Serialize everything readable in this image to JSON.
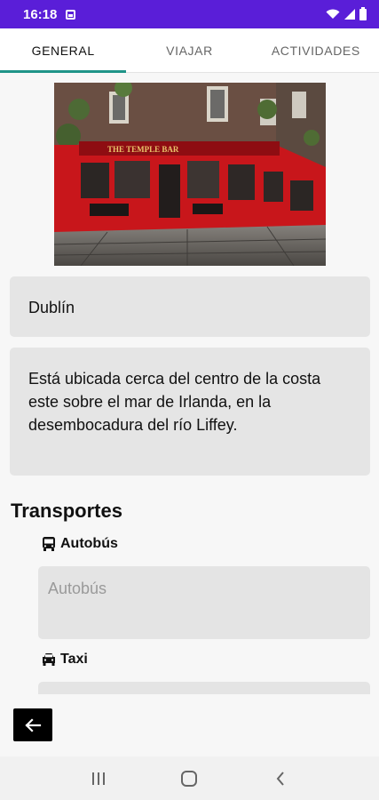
{
  "status_bar": {
    "time": "16:18"
  },
  "tabs": [
    {
      "label": "GENERAL",
      "active": true
    },
    {
      "label": "VIAJAR",
      "active": false
    },
    {
      "label": "ACTIVIDADES",
      "active": false
    }
  ],
  "city": {
    "name": "Dublín",
    "description": "Está ubicada cerca del centro de la costa este sobre el mar de Irlanda, en la desembocadura del río Liffey.",
    "image_sign_text": "THE TEMPLE BAR"
  },
  "transport": {
    "title": "Transportes",
    "bus": {
      "label": "Autobús",
      "placeholder": "Autobús"
    },
    "taxi": {
      "label": "Taxi"
    }
  },
  "colors": {
    "status_bar": "#5a1ed8",
    "tab_indicator": "#1f9488",
    "pub_red": "#c8161b"
  },
  "icons": {
    "back": "arrow-left-icon",
    "bus": "bus-icon",
    "taxi": "taxi-icon",
    "nav_recents": "recents-icon",
    "nav_home": "home-icon",
    "nav_back": "back-chevron-icon"
  }
}
